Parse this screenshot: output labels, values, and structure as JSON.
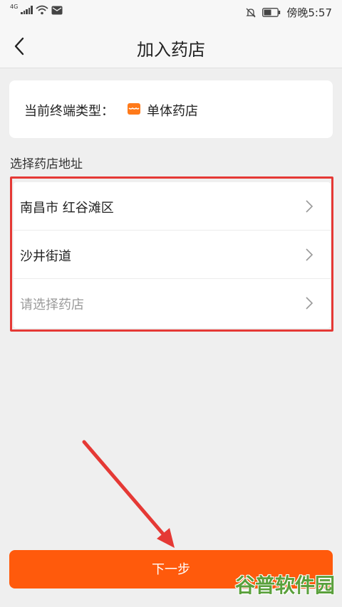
{
  "status_bar": {
    "network_label": "4G",
    "time": "傍晚5:57",
    "icons": [
      "signal-icon",
      "wifi-icon",
      "mail-icon",
      "mute-bell-icon",
      "battery-icon"
    ]
  },
  "header": {
    "title": "加入药店",
    "back_icon": "chevron-left-icon"
  },
  "terminal": {
    "label": "当前终端类型：",
    "value": "单体药店",
    "icon": "pharmacy-icon",
    "icon_color": "#ff7a1a"
  },
  "address_section": {
    "title": "选择药店地址",
    "rows": [
      {
        "text": "南昌市 红谷滩区",
        "placeholder": false
      },
      {
        "text": "沙井街道",
        "placeholder": false
      },
      {
        "text": "请选择药店",
        "placeholder": true
      }
    ]
  },
  "next_button": {
    "label": "下一步",
    "color": "#ff5a0c"
  },
  "annotations": {
    "highlight_color": "#e53935"
  },
  "watermark": {
    "text": "谷普软件园"
  }
}
